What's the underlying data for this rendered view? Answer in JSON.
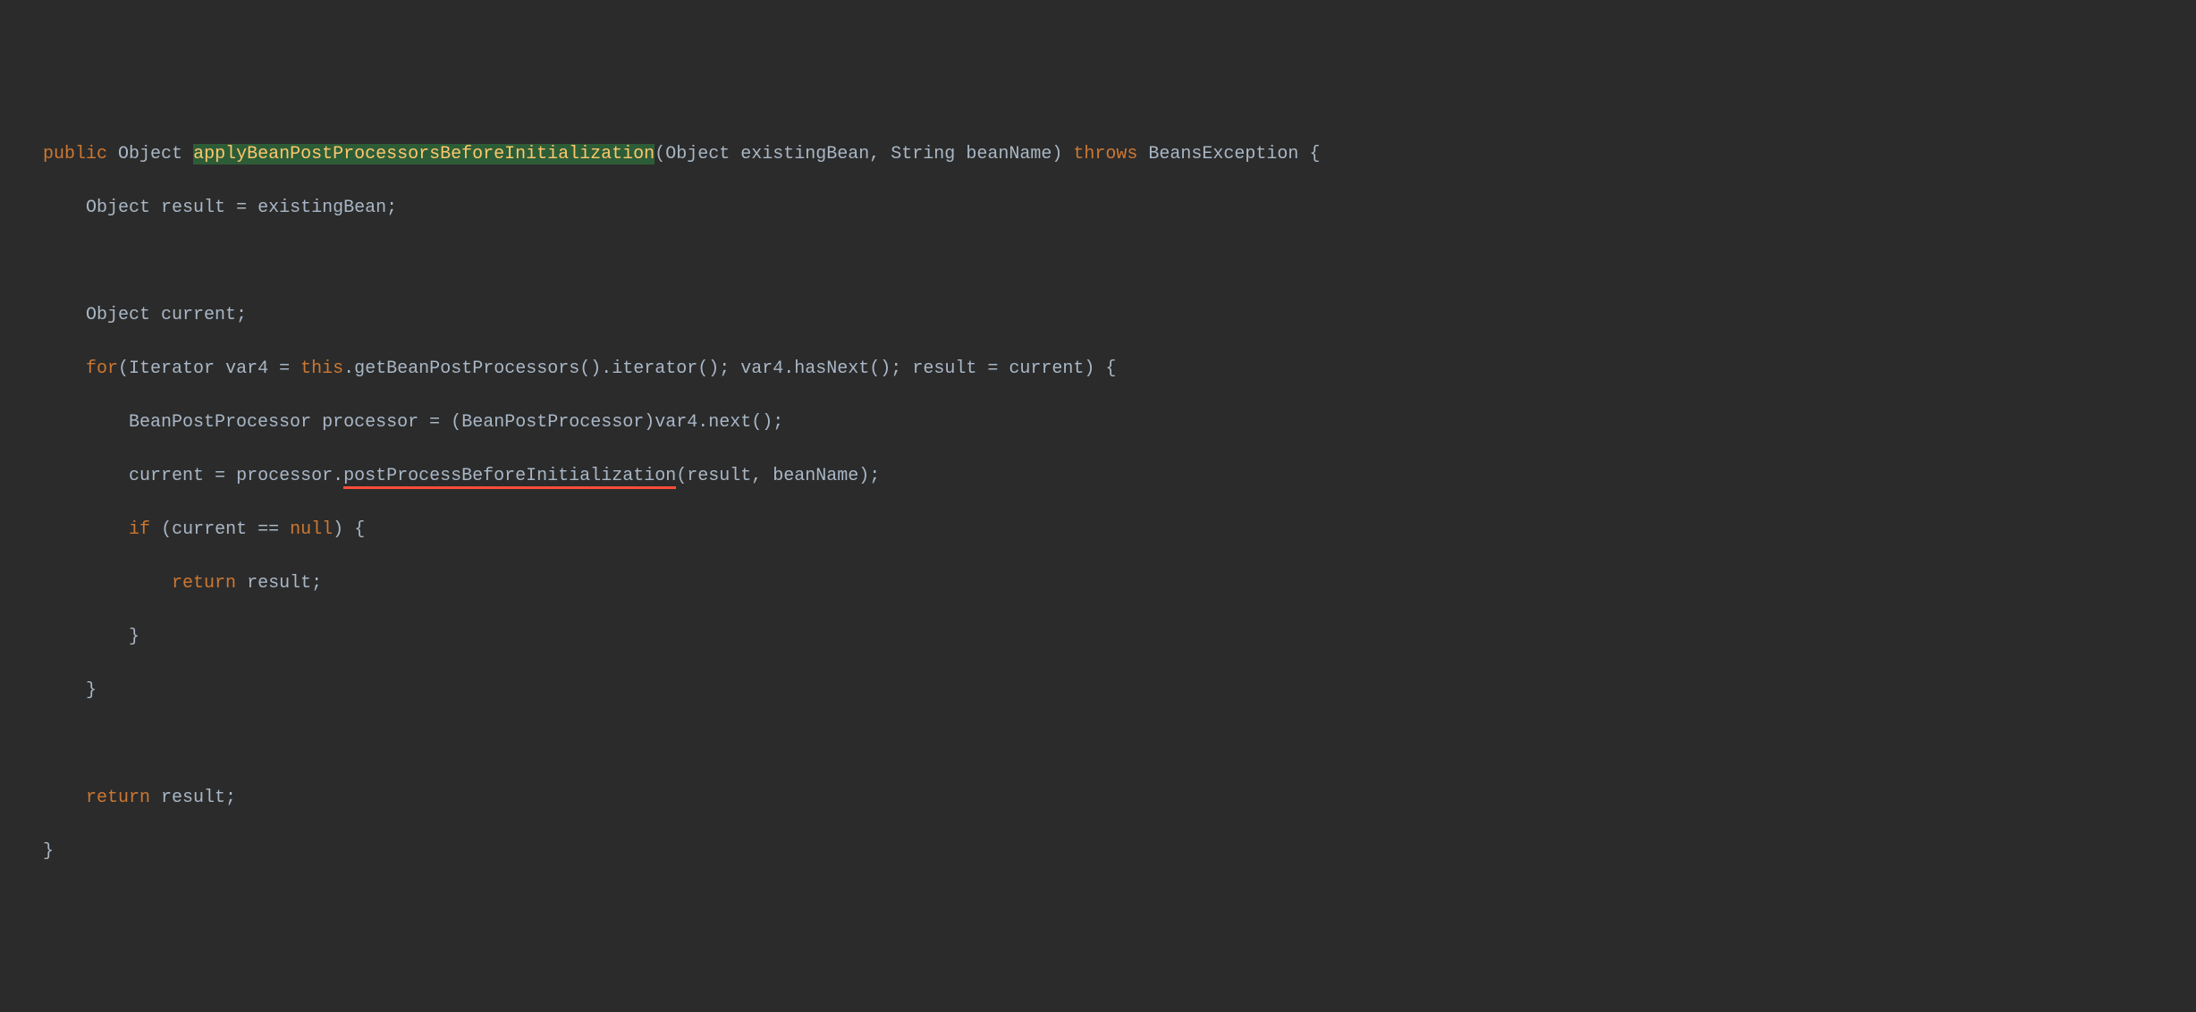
{
  "code": {
    "l1": {
      "kw_public": "public",
      "type_object": "Object",
      "method_name": "applyBeanPostProcessorsBeforeInitialization",
      "paren_open": "(",
      "param1_type": "Object",
      "param1_name": "existingBean",
      "comma": ",",
      "param2_type": "String",
      "param2_name": "beanName",
      "paren_close": ")",
      "kw_throws": "throws",
      "exception": "BeansException",
      "brace": "{"
    },
    "l2": {
      "indent": "        ",
      "type": "Object",
      "var": "result",
      "op": "=",
      "val": "existingBean;"
    },
    "l3": {
      "blank": ""
    },
    "l4": {
      "indent": "        ",
      "type": "Object",
      "var": "current;"
    },
    "l5": {
      "indent": "        ",
      "kw_for": "for",
      "paren_open": "(",
      "type": "Iterator",
      "var": "var4",
      "op": "=",
      "kw_this": "this",
      "dot1": ".",
      "call1": "getBeanPostProcessors().iterator();",
      "cond": "var4.hasNext();",
      "upd": "result = current)",
      "brace": "{"
    },
    "l6": {
      "indent": "            ",
      "type": "BeanPostProcessor",
      "var": "processor",
      "op": "=",
      "cast_open": "(",
      "cast_type": "BeanPostProcessor",
      "cast_close": ")",
      "call": "var4.next();"
    },
    "l7": {
      "indent": "            ",
      "lhs": "current",
      "op": "=",
      "obj": "processor",
      "dot": ".",
      "method": "postProcessBeforeInitialization",
      "paren_open": "(",
      "arg1": "result",
      "comma": ",",
      "arg2": "beanName",
      "paren_close": ");"
    },
    "l8": {
      "indent": "            ",
      "kw_if": "if",
      "paren_open": "(",
      "lhs": "current",
      "op": "==",
      "kw_null": "null",
      "paren_close": ")",
      "brace": "{"
    },
    "l9": {
      "indent": "                ",
      "kw_return": "return",
      "val": "result;"
    },
    "l10": {
      "indent": "            ",
      "brace": "}"
    },
    "l11": {
      "indent": "        ",
      "brace": "}"
    },
    "l12": {
      "blank": ""
    },
    "l13": {
      "indent": "        ",
      "kw_return": "return",
      "val": "result;"
    },
    "l14": {
      "indent": "    ",
      "brace": "}"
    }
  }
}
